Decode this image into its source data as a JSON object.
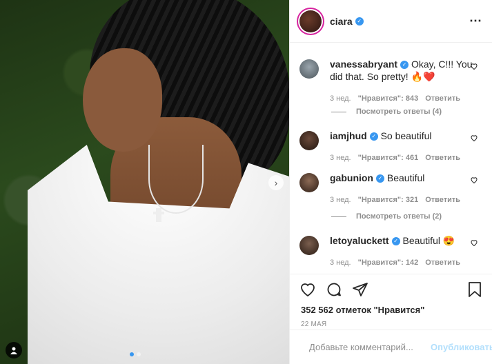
{
  "post": {
    "author": "ciara",
    "more_icon": "⋯"
  },
  "comments": [
    {
      "author": "vanessabryant",
      "text": "Okay, C!!! You did that. So pretty! 🔥❤️",
      "time": "3 нед.",
      "likes": "\"Нравится\": 843",
      "reply": "Ответить",
      "view_replies": "Посмотреть ответы (4)"
    },
    {
      "author": "iamjhud",
      "text": "So beautiful",
      "time": "3 нед.",
      "likes": "\"Нравится\": 461",
      "reply": "Ответить"
    },
    {
      "author": "gabunion",
      "text": "Beautiful",
      "time": "3 нед.",
      "likes": "\"Нравится\": 321",
      "reply": "Ответить",
      "view_replies": "Посмотреть ответы (2)"
    },
    {
      "author": "letoyaluckett",
      "text": "Beautiful 😍",
      "time": "3 нед.",
      "likes": "\"Нравится\": 142",
      "reply": "Ответить"
    }
  ],
  "stats": {
    "likes": "352 562 отметок \"Нравится\"",
    "date": "22 МАЯ"
  },
  "composer": {
    "placeholder": "Добавьте комментарий...",
    "publish": "Опубликовать"
  },
  "colors": {
    "verified": "#3897f0",
    "publish_disabled": "#b2dffc",
    "story_ring": "#d6249f"
  },
  "carousel": {
    "slide_count": 2,
    "active_index": 0
  }
}
